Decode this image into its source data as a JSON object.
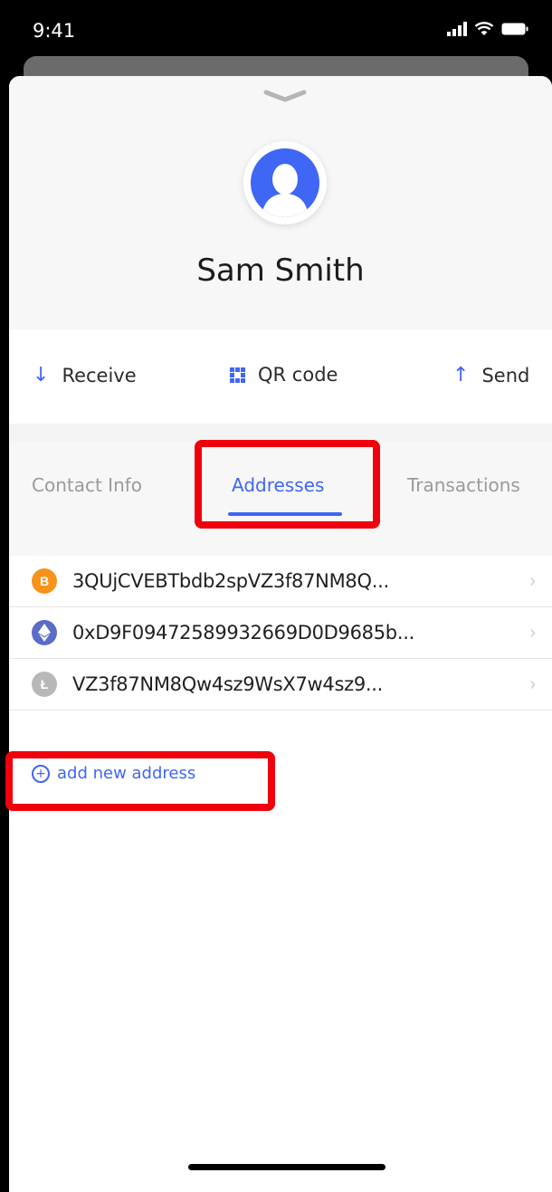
{
  "status_bar": {
    "time": "9:41",
    "icons": [
      "signal-icon",
      "wifi-icon",
      "battery-icon"
    ]
  },
  "contact": {
    "name": "Sam Smith",
    "avatar_icon": "user-avatar-icon"
  },
  "actions": [
    {
      "label": "Receive",
      "icon": "arrow-down-icon"
    },
    {
      "label": "QR code",
      "icon": "qr-code-icon"
    },
    {
      "label": "Send",
      "icon": "arrow-up-icon"
    }
  ],
  "tabs": [
    {
      "label": "Contact Info",
      "active": false
    },
    {
      "label": "Addresses",
      "active": true
    },
    {
      "label": "Transactions",
      "active": false
    }
  ],
  "addresses": [
    {
      "coin": "bitcoin",
      "coin_symbol": "B",
      "coin_color": "#f7931a",
      "address": "3QUjCVEBTbdb2spVZ3f87NM8Q..."
    },
    {
      "coin": "ethereum",
      "coin_symbol": "",
      "coin_color": "#5b6bc8",
      "address": "0xD9F09472589932669D0D9685b..."
    },
    {
      "coin": "litecoin",
      "coin_symbol": "Ł",
      "coin_color": "#b8b8b8",
      "address": "VZ3f87NM8Qw4sz9WsX7w4sz9..."
    }
  ],
  "add_address": {
    "label": "add new address"
  },
  "colors": {
    "accent": "#3f66f5",
    "highlight": "#f0000b"
  }
}
